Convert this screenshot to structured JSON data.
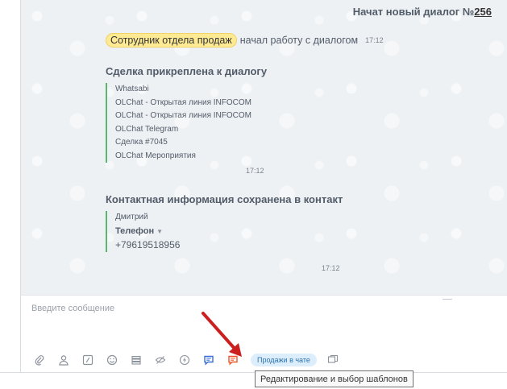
{
  "chat": {
    "header_prefix": "Начат новый диалог №",
    "dialog_number": "256",
    "role_badge": "Сотрудник отдела продаж",
    "role_text": "начал работу с диалогом",
    "role_time": "17:12",
    "deal_block": {
      "title": "Сделка прикреплена к диалогу",
      "items": [
        "Whatsabi",
        "OLChat - Открытая линия INFOCOM",
        "OLChat - Открытая линия INFOCOM",
        "OLChat Telegram",
        "Сделка #7045",
        "OLChat Мероприятия"
      ],
      "time": "17:12"
    },
    "contact_block": {
      "title": "Контактная информация сохранена в контакт",
      "name": "Дмитрий",
      "phone_label": "Телефон",
      "phone": "+79619518956",
      "time": "17:12"
    }
  },
  "input": {
    "placeholder": "Введите сообщение"
  },
  "toolbar": {
    "icons": [
      "paperclip-icon",
      "user-icon",
      "slash-icon",
      "smile-icon",
      "stack-icon",
      "hidden-icon",
      "bolt-icon",
      "chat-blue-icon",
      "template-chat-icon"
    ],
    "sales_chip": "Продажи в чате"
  },
  "tooltip": {
    "text": "Редактирование и выбор шаблонов"
  },
  "colors": {
    "accent_blue": "#3b6fd8",
    "accent_orange": "#f0562a",
    "badge_yellow": "#fdea92",
    "arrow_red": "#cc1f1f",
    "line_green": "#5bb56c"
  }
}
